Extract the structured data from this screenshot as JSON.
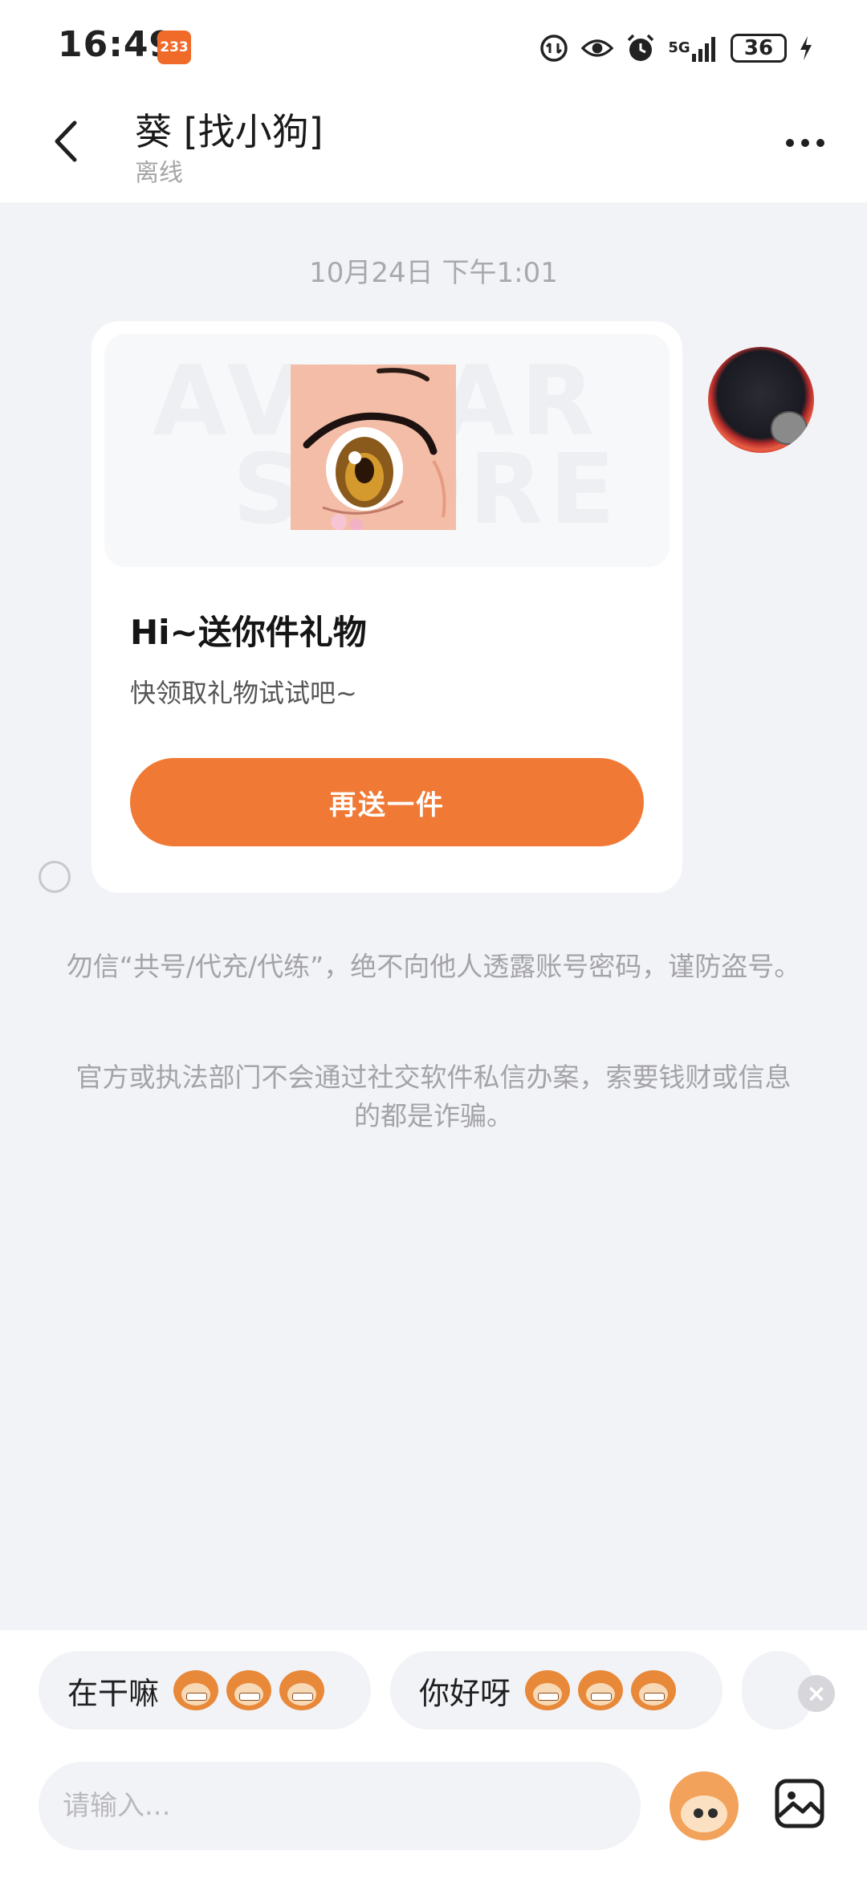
{
  "status_bar": {
    "time": "16:49",
    "notification_badge": "233",
    "network": "5G",
    "battery": "36"
  },
  "header": {
    "title": "葵 [找小狗]",
    "status": "离线"
  },
  "chat": {
    "timestamp": "10月24日 下午1:01",
    "gift_card": {
      "title": "Hi~送你件礼物",
      "subtitle": "快领取礼物试试吧~",
      "button_label": "再送一件"
    },
    "warnings": [
      "勿信“共号/代充/代练”，绝不向他人透露账号密码，谨防盗号。",
      "官方或执法部门不会通过社交软件私信办案，索要钱财或信息的都是诈骗。"
    ]
  },
  "quick_replies": [
    {
      "label": "在干嘛"
    },
    {
      "label": "你好呀"
    }
  ],
  "composer": {
    "placeholder": "请输入..."
  },
  "colors": {
    "accent": "#f07a35",
    "background": "#f2f3f7"
  }
}
